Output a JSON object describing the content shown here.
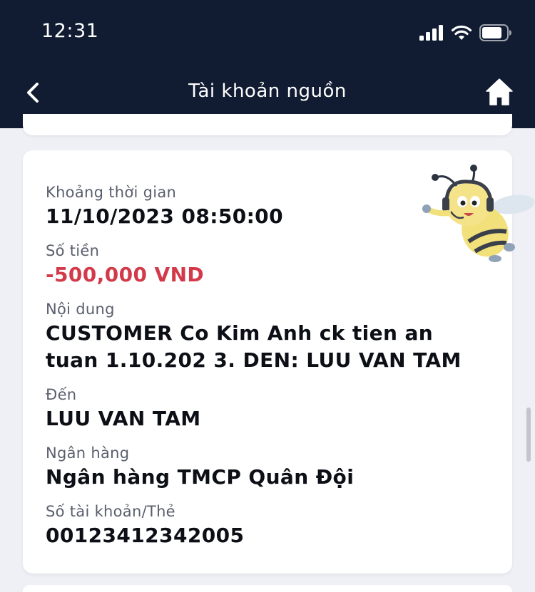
{
  "status_bar": {
    "time": "12:31"
  },
  "header": {
    "title": "Tài khoản nguồn",
    "back_icon": "chevron-left-icon",
    "home_icon": "home-icon"
  },
  "transaction": {
    "time_label": "Khoảng thời gian",
    "time_value": "11/10/2023 08:50:00",
    "amount_label": "Số tiền",
    "amount_value": "-500,000 VND",
    "content_label": "Nội dung",
    "content_line1": "CUSTOMER Co Kim Anh ck tien an",
    "content_line2": "tuan 1.10.202 3. DEN: LUU VAN TAM",
    "to_label": "Đến",
    "to_value": "LUU VAN TAM",
    "bank_label": "Ngân hàng",
    "bank_value": "Ngân hàng TMCP Quân Đội",
    "account_label": "Số tài khoản/Thẻ",
    "account_value": "00123412342005"
  },
  "colors": {
    "header_bg": "#111c33",
    "page_bg": "#eef0f5",
    "amount_negative": "#d23a4a"
  }
}
